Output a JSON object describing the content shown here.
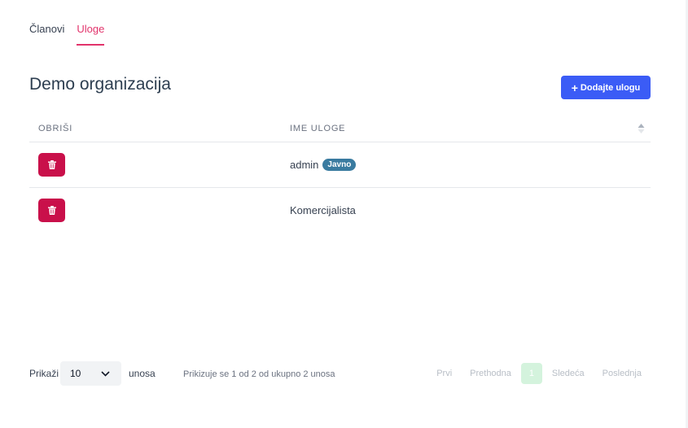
{
  "tabs": [
    {
      "label": "Članovi",
      "active": false
    },
    {
      "label": "Uloge",
      "active": true
    }
  ],
  "page": {
    "title": "Demo organizacija"
  },
  "toolbar": {
    "add_label": "Dodajte ulogu",
    "add_icon": "plus-icon",
    "accent": "#3b5cf6"
  },
  "table": {
    "headers": [
      "OBRIŠI",
      "IME ULOGE"
    ],
    "rows": [
      {
        "name": "admin",
        "badge": "Javno"
      },
      {
        "name": "Komercijalista",
        "badge": null
      }
    ],
    "delete_icon": "trash-icon",
    "delete_color": "#c9104a",
    "badge_color": "#3a7ba0"
  },
  "footer": {
    "show_label": "Prikaži",
    "page_length": "10",
    "entries_label": "unosa",
    "info": "Prikizuje se 1 od 2 od ukupno 2 unosa",
    "pagination": {
      "first": "Prvi",
      "previous": "Prethodna",
      "current": "1",
      "next": "Sledeća",
      "last": "Poslednja"
    }
  }
}
